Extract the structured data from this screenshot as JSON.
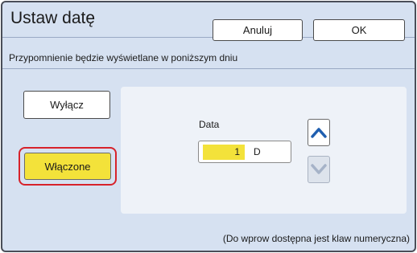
{
  "header": {
    "title": "Ustaw datę",
    "cancel_label": "Anuluj",
    "ok_label": "OK"
  },
  "subtitle": "Przypomnienie będzie wyświetlane w poniższym dniu",
  "mode": {
    "off_label": "Wyłącz",
    "on_label": "Włączone",
    "selected": "Włączone"
  },
  "date": {
    "label": "Data",
    "value": "1",
    "unit": "D"
  },
  "icons": {
    "up": "chevron-up-icon",
    "down": "chevron-down-icon"
  },
  "footer": "(Do wprow dostępna jest klaw numeryczna)",
  "colors": {
    "background": "#d6e1f1",
    "selected": "#f3e23a",
    "highlight_ring": "#d7222b",
    "arrow_active": "#1f5fb0",
    "arrow_disabled": "#a6b3c8"
  }
}
